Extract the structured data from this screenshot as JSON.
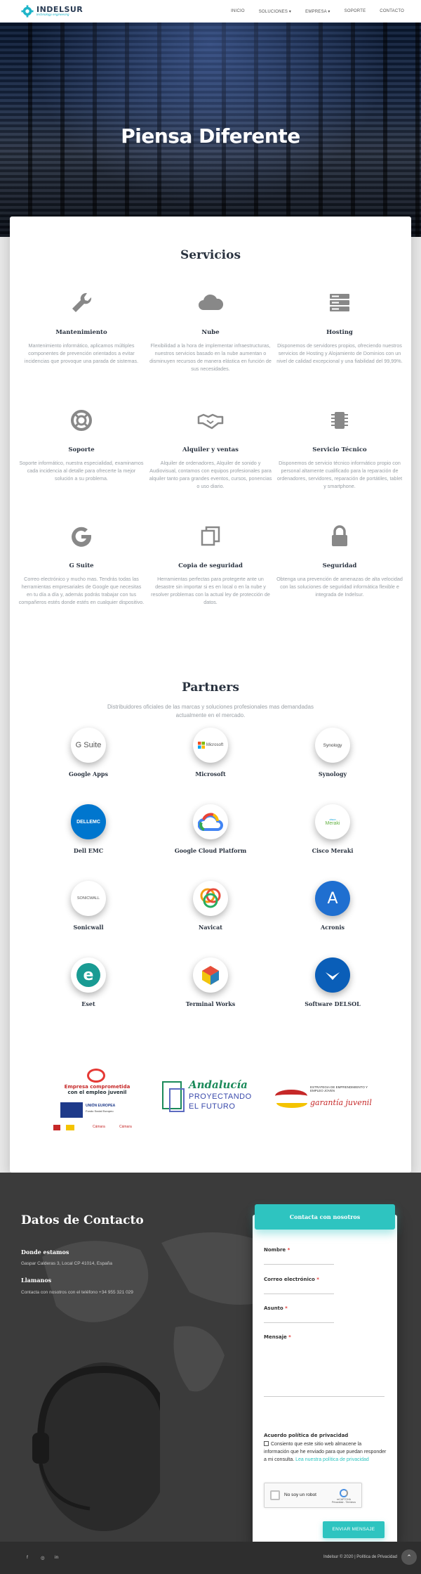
{
  "nav": {
    "brand_name": "INDELSUR",
    "brand_tagline": "technology engineering",
    "links": [
      "INICIO",
      "SOLUCIONES ▾",
      "EMPRESA ▾",
      "SOPORTE",
      "CONTACTO"
    ]
  },
  "hero": {
    "title": "Piensa Diferente"
  },
  "services": {
    "title": "Servicios",
    "items": [
      {
        "icon": "wrench-icon",
        "title": "Mantenimiento",
        "desc": "Mantenimiento informático, aplicamos múltiples componentes de prevención orientados a evitar incidencias que provoque una parada de sistemas."
      },
      {
        "icon": "cloud-icon",
        "title": "Nube",
        "desc": "Flexibilidad a la hora de implementar infraestructuras, nuestros servicios basado en la nube aumentan o disminuyen recursos de manera elástica en función de sus necesidades."
      },
      {
        "icon": "server-icon",
        "title": "Hosting",
        "desc": "Disponemos de servidores propios, ofreciendo nuestros servicios de Hosting y Alojamiento de Dominios con un nivel de calidad excepcional y una fiabilidad del 99,99%."
      },
      {
        "icon": "lifebuoy-icon",
        "title": "Soporte",
        "desc": "Soporte informático, nuestra especialidad, examinamos cada incidencia al detalle para ofrecerte la mejor solución a su problema."
      },
      {
        "icon": "handshake-icon",
        "title": "Alquiler y ventas",
        "desc": "Alquiler de ordenadores, Alquiler de sonido y Audiovisual, contamos con equipos profesionales para alquiler tanto para grandes eventos, cursos, ponencias o uso diario."
      },
      {
        "icon": "chip-icon",
        "title": "Servicio Técnico",
        "desc": "Disponemos de servicio técnico informático propio con personal altamente cualificado para la reparación de ordenadores, servidores, reparación de portátiles, tablet y smartphone."
      },
      {
        "icon": "google-g-icon",
        "title": "G Suite",
        "desc": "Correo electrónico y mucho mas. Tendrás todas las herramientas empresariales de Google que necesitas en tu día a día y, además podrás trabajar con tus compañeros estés donde estés en cualquier dispositivo."
      },
      {
        "icon": "copy-icon",
        "title": "Copia de seguridad",
        "desc": "Herramientas perfectas para protegerte ante un desastre sin importar si es en local o en la nube y resolver problemas con la actual ley de protección de datos."
      },
      {
        "icon": "lock-icon",
        "title": "Seguridad",
        "desc": "Obtenga una prevención de amenazas de alta velocidad con las soluciones de seguridad informática flexible e integrada de Indelsur."
      }
    ]
  },
  "partners": {
    "title": "Partners",
    "subtitle": "Distribuidores oficiales de las marcas y soluciones profesionales mas demandadas actualmente en el mercado.",
    "items": [
      {
        "name": "Google Apps",
        "logo": "gsuite-logo",
        "mark": "G Suite"
      },
      {
        "name": "Microsoft",
        "logo": "microsoft-logo",
        "mark": "Microsoft"
      },
      {
        "name": "Synology",
        "logo": "synology-logo",
        "mark": "Synology"
      },
      {
        "name": "Dell EMC",
        "logo": "dell-emc-logo",
        "mark": "DELLEMC"
      },
      {
        "name": "Google Cloud Platform",
        "logo": "google-cloud-logo",
        "mark": ""
      },
      {
        "name": "Cisco Meraki",
        "logo": "cisco-meraki-logo",
        "mark": "Meraki"
      },
      {
        "name": "Sonicwall",
        "logo": "sonicwall-logo",
        "mark": "SONICWALL"
      },
      {
        "name": "Navicat",
        "logo": "navicat-logo",
        "mark": ""
      },
      {
        "name": "Acronis",
        "logo": "acronis-logo",
        "mark": "A"
      },
      {
        "name": "Eset",
        "logo": "eset-logo",
        "mark": "e"
      },
      {
        "name": "Terminal Works",
        "logo": "terminal-works-logo",
        "mark": ""
      },
      {
        "name": "Software DELSOL",
        "logo": "delsol-logo",
        "mark": ""
      }
    ]
  },
  "sponsors": {
    "empleo_line1": "Empresa comprometida",
    "empleo_line2": "con el empleo juvenil",
    "ue": "UNIÓN EUROPEA",
    "fse": "Fondo Social Europeo",
    "andalucia1": "Andalucía",
    "andalucia2": "PROYECTANDO",
    "andalucia3": "EL FUTURO",
    "garantia_head": "ESTRATEGIA DE EMPRENDIMIENTO Y EMPLEO JOVEN",
    "garantia": "garantía juvenil",
    "camara": "Cámara"
  },
  "contact": {
    "title": "Datos de Contacto",
    "where_label": "Donde estamos",
    "address": "Gaspar Calderas 3, Local CP 41014, España",
    "call_label": "Llamanos",
    "phone_text": "Contacta con nosotros con el teléfono +34 955 321 029",
    "form": {
      "header": "Contacta con nosotros",
      "name_label": "Nombre",
      "email_label": "Correo electrónico",
      "subject_label": "Asunto",
      "message_label": "Mensaje",
      "required_mark": "*",
      "consent_title": "Acuerdo política de privacidad",
      "consent_text": "Consiento que este sitio web almacene la información que he enviado para que puedan responder a mi consulta.",
      "consent_link": "Lea nuestra política de privacidad",
      "captcha_text": "No soy un robot",
      "captcha_brand": "reCAPTCHA",
      "captcha_terms": "Privacidad - Términos",
      "submit": "ENVIAR MENSAJE"
    }
  },
  "footer": {
    "social": [
      "f",
      "◎",
      "in"
    ],
    "copyright": "Indelsur © 2020 | Política de Privacidad",
    "scroll_top": "⌃"
  },
  "colors": {
    "accent": "#2ec4c0",
    "dark": "#3b3b3b",
    "text": "#3c4858",
    "muted": "#9aa0a6"
  }
}
